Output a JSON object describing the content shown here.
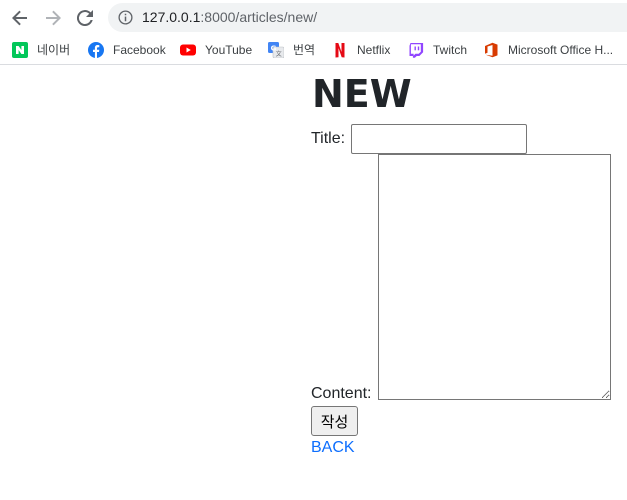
{
  "browser": {
    "url_host": "127.0.0.1",
    "url_path": ":8000/articles/new/",
    "back_icon": "arrow-left-icon",
    "forward_icon": "arrow-right-icon",
    "reload_icon": "reload-icon",
    "info_icon": "info-icon"
  },
  "bookmarks": [
    {
      "label": "네이버",
      "icon": "naver-icon",
      "color": "#03c75a"
    },
    {
      "label": "Facebook",
      "icon": "facebook-icon",
      "color": "#1877f2"
    },
    {
      "label": "YouTube",
      "icon": "youtube-icon",
      "color": "#ff0000"
    },
    {
      "label": "번역",
      "icon": "google-translate-icon",
      "color": "#4285f4"
    },
    {
      "label": "Netflix",
      "icon": "netflix-icon",
      "color": "#e50914"
    },
    {
      "label": "Twitch",
      "icon": "twitch-icon",
      "color": "#9146ff"
    },
    {
      "label": "Microsoft Office H...",
      "icon": "office-icon",
      "color": "#d83b01"
    }
  ],
  "page": {
    "heading": "NEW",
    "title_label": "Title:",
    "title_value": "",
    "content_label": "Content:",
    "content_value": "",
    "submit_label": "작성",
    "back_label": "BACK",
    "link_color": "#0d6efd"
  }
}
